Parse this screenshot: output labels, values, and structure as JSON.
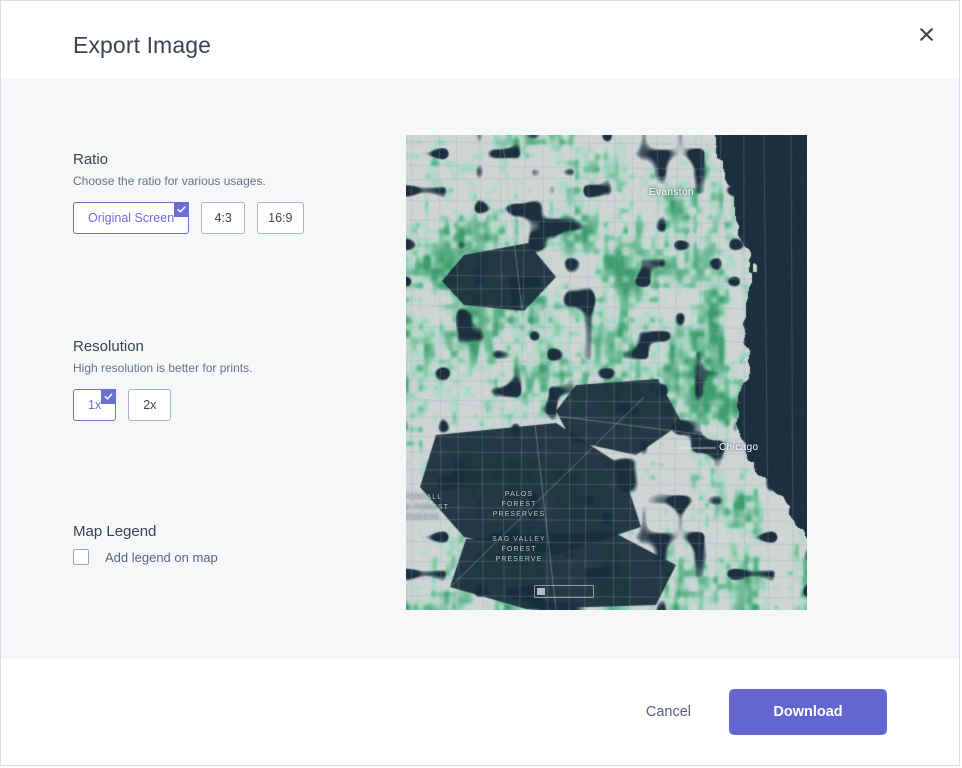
{
  "dialog": {
    "title": "Export Image",
    "close_icon": "close-icon"
  },
  "ratio": {
    "heading": "Ratio",
    "subtitle": "Choose the ratio for various usages.",
    "options": [
      {
        "label": "Original Screen",
        "selected": true
      },
      {
        "label": "4:3",
        "selected": false
      },
      {
        "label": "16:9",
        "selected": false
      }
    ]
  },
  "resolution": {
    "heading": "Resolution",
    "subtitle": "High resolution is better for prints.",
    "options": [
      {
        "label": "1x",
        "selected": true
      },
      {
        "label": "2x",
        "selected": false
      }
    ]
  },
  "legend": {
    "heading": "Map Legend",
    "checkbox_label": "Add legend on map",
    "checked": false
  },
  "preview": {
    "labels": {
      "evanston": "Evanston",
      "chicago": "Chicago",
      "palos": "PALOS FOREST PRESERVES",
      "sag": "SAG VALLEY FOREST PRESERVE",
      "waterfall": "WATERFALL GLEN FOREST PRESERVE"
    },
    "colors": {
      "water": "#1d3040",
      "land": "#cfd4d4",
      "green_light": "#aed8c8",
      "green_mid": "#76bf9b",
      "green_dark": "#3f9e6e"
    }
  },
  "footer": {
    "cancel_label": "Cancel",
    "download_label": "Download"
  },
  "theme": {
    "accent": "#6366cf",
    "accent_border": "#6a6fd4",
    "text_dark": "#3b4353",
    "text_muted": "#69718a",
    "body_bg": "#f6f7f9"
  }
}
